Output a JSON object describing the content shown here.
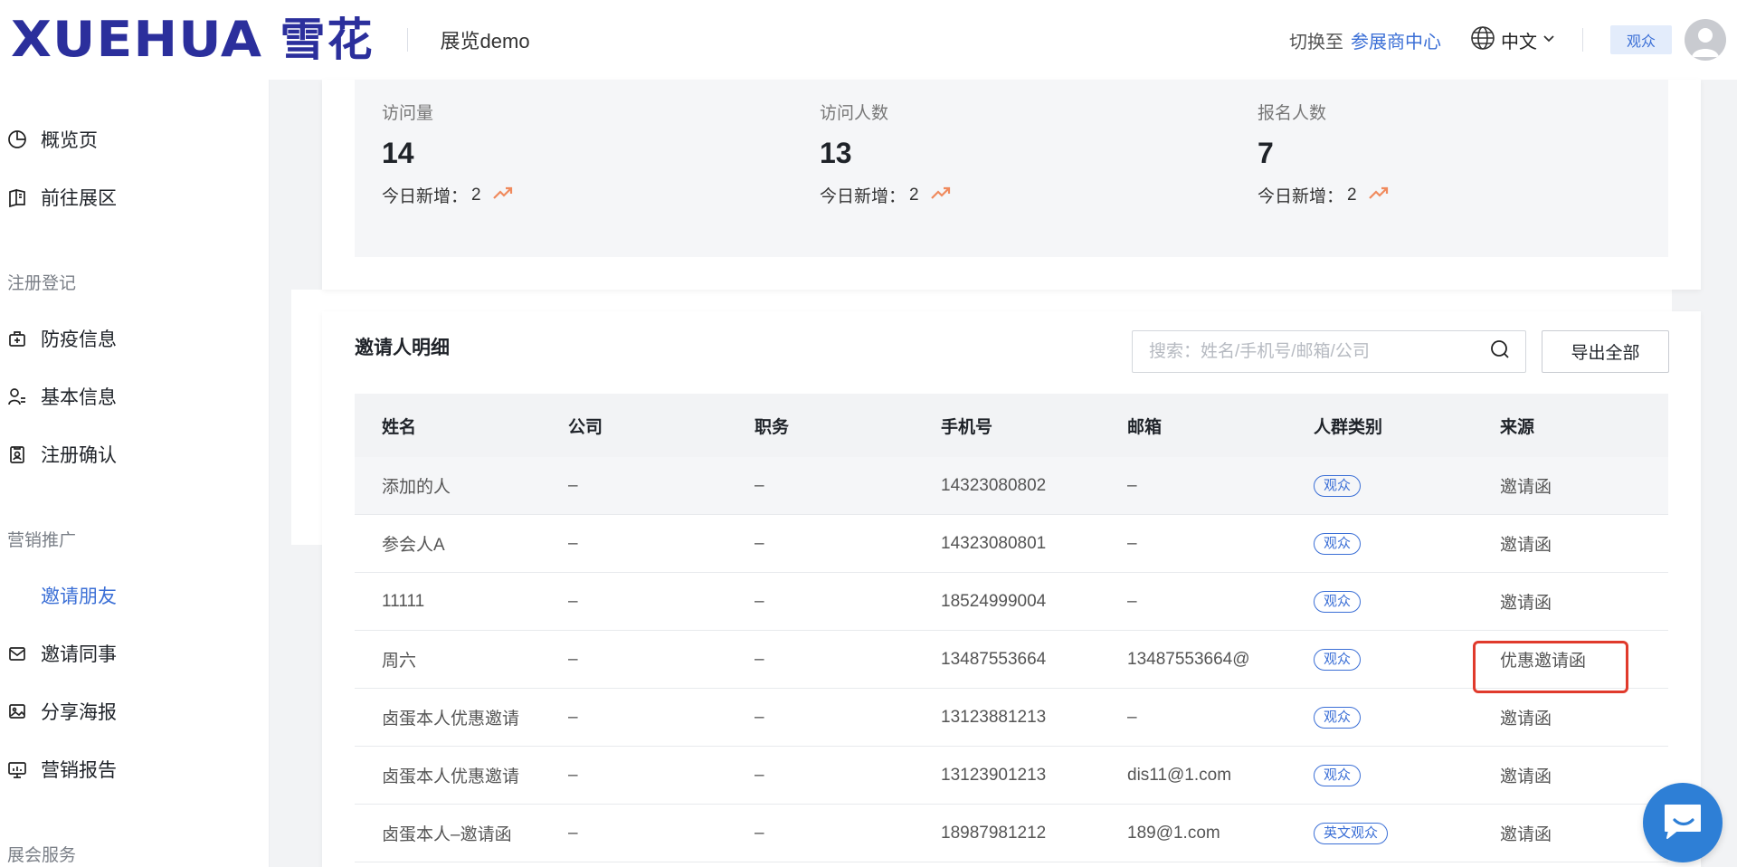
{
  "header": {
    "logo_text": "XUEHUA",
    "logo_cn": "雪花",
    "app_name": "展览demo",
    "switch_text": "切换至",
    "switch_link": "参展商中心",
    "language": "中文",
    "role_badge": "观众",
    "icons": {
      "language": "globe-icon",
      "dropdown": "chevron-down-icon",
      "avatar": "user-avatar-icon"
    }
  },
  "sidebar": {
    "items_top": [
      {
        "label": "概览页",
        "icon": "pie-chart-icon"
      },
      {
        "label": "前往展区",
        "icon": "map-book-icon"
      }
    ],
    "section_register": "注册登记",
    "items_register": [
      {
        "label": "防疫信息",
        "icon": "health-bag-icon"
      },
      {
        "label": "基本信息",
        "icon": "user-list-icon"
      },
      {
        "label": "注册确认",
        "icon": "id-badge-icon"
      }
    ],
    "section_marketing": "营销推广",
    "items_marketing": [
      {
        "label": "邀请朋友",
        "active": true
      },
      {
        "label": "邀请同事",
        "icon": "mail-icon"
      },
      {
        "label": "分享海报",
        "icon": "image-icon"
      },
      {
        "label": "营销报告",
        "icon": "monitor-chart-icon"
      }
    ],
    "section_service": "展会服务"
  },
  "stats": [
    {
      "label": "访问量",
      "value": "14",
      "new_label": "今日新增：",
      "new_value": "2"
    },
    {
      "label": "访问人数",
      "value": "13",
      "new_label": "今日新增：",
      "new_value": "2"
    },
    {
      "label": "报名人数",
      "value": "7",
      "new_label": "今日新增：",
      "new_value": "2"
    }
  ],
  "table_card": {
    "title": "邀请人明细",
    "search_placeholder": "搜索：姓名/手机号/邮箱/公司",
    "export_label": "导出全部",
    "columns": [
      "姓名",
      "公司",
      "职务",
      "手机号",
      "邮箱",
      "人群类别",
      "来源"
    ],
    "rows": [
      {
        "name": "添加的人",
        "company": "–",
        "title": "–",
        "phone": "14323080802",
        "email": "–",
        "category": "观众",
        "source": "邀请函"
      },
      {
        "name": "参会人A",
        "company": "–",
        "title": "–",
        "phone": "14323080801",
        "email": "–",
        "category": "观众",
        "source": "邀请函"
      },
      {
        "name": "11111",
        "company": "–",
        "title": "–",
        "phone": "18524999004",
        "email": "–",
        "category": "观众",
        "source": "邀请函"
      },
      {
        "name": "周六",
        "company": "–",
        "title": "–",
        "phone": "13487553664",
        "email": "13487553664@",
        "category": "观众",
        "source": "优惠邀请函"
      },
      {
        "name": "卤蛋本人优惠邀请",
        "company": "–",
        "title": "–",
        "phone": "13123881213",
        "email": "–",
        "category": "观众",
        "source": "邀请函"
      },
      {
        "name": "卤蛋本人优惠邀请",
        "company": "–",
        "title": "–",
        "phone": "13123901213",
        "email": "dis11@1.com",
        "category": "观众",
        "source": "邀请函"
      },
      {
        "name": "卤蛋本人–邀请函",
        "company": "–",
        "title": "–",
        "phone": "18987981212",
        "email": "189@1.com",
        "category": "英文观众",
        "source": "邀请函"
      }
    ]
  },
  "colors": {
    "brand": "#2b2f9c",
    "accent": "#3b6fd6",
    "highlight": "#e03a2c",
    "chat": "#2e7fd6"
  }
}
